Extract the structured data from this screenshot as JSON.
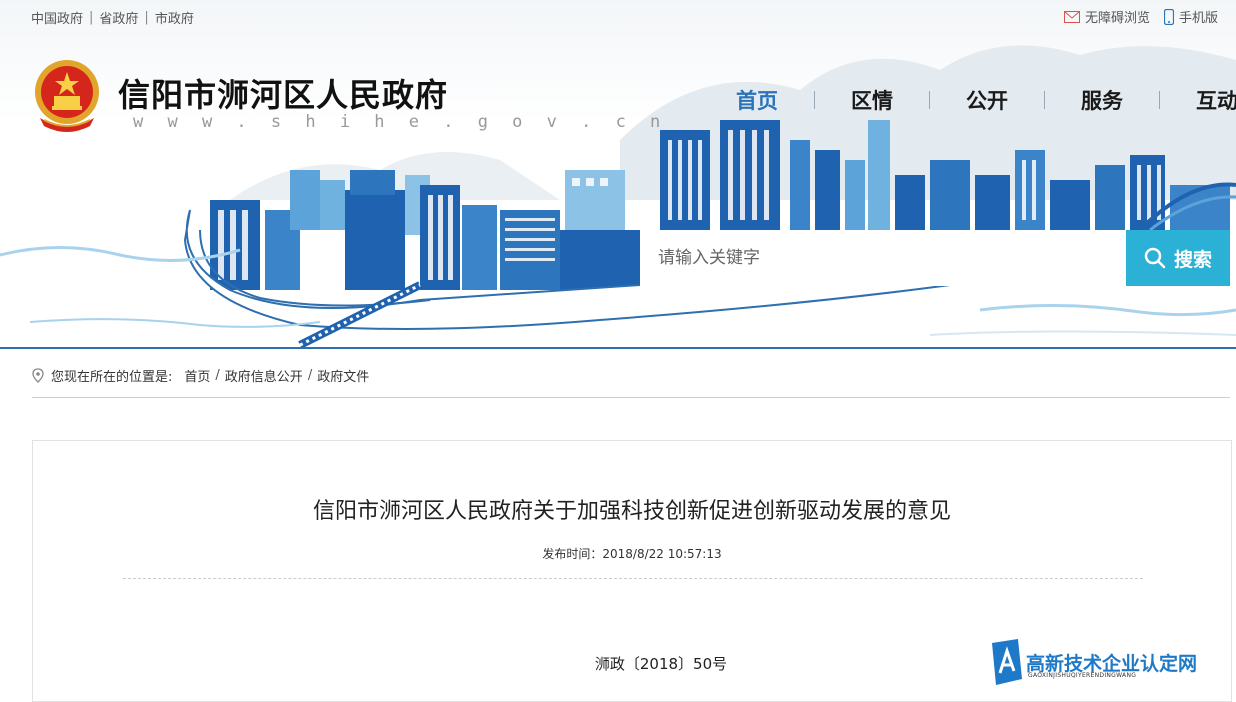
{
  "top_links": [
    "中国政府",
    "省政府",
    "市政府"
  ],
  "accessibility_label": "无障碍浏览",
  "mobile_label": "手机版",
  "site": {
    "title": "信阳市浉河区人民政府",
    "url": "w w w . s h i h e . g o v . c n"
  },
  "nav": {
    "items": [
      "首页",
      "区情",
      "公开",
      "服务",
      "互动"
    ],
    "active_index": 0
  },
  "search": {
    "placeholder": "请输入关键字",
    "button_label": "搜索"
  },
  "breadcrumb": {
    "prefix": "您现在所在的位置是:",
    "items": [
      "首页",
      "政府信息公开",
      "政府文件"
    ],
    "separator": "/"
  },
  "article": {
    "title": "信阳市浉河区人民政府关于加强科技创新促进创新驱动发展的意见",
    "meta": "发布时间：2018/8/22 10:57:13",
    "doc_number": "浉政〔2018〕50号"
  },
  "watermark": {
    "text": "高新技术企业认定网",
    "sub": "GAOXINJISHUQIYERENDINGWANG"
  },
  "colors": {
    "accent": "#2a73b8",
    "search_button": "#2bb0d6",
    "city_blue": "#2f6fb0"
  }
}
